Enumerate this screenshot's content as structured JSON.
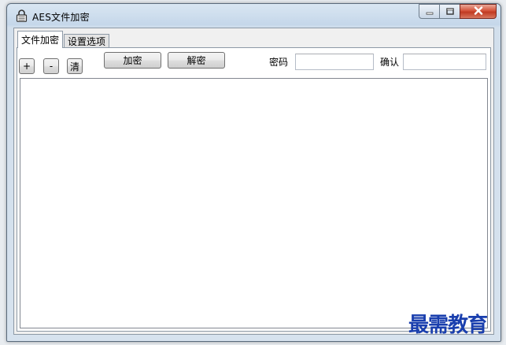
{
  "window": {
    "title": "AES文件加密"
  },
  "tabs": [
    {
      "label": "文件加密"
    },
    {
      "label": "设置选项"
    }
  ],
  "toolbar": {
    "add_label": "+",
    "remove_label": "-",
    "clear_label": "清",
    "encrypt_label": "加密",
    "decrypt_label": "解密"
  },
  "fields": {
    "password_label": "密码",
    "password_value": "",
    "confirm_label": "确认",
    "confirm_value": ""
  },
  "file_list": {
    "value": ""
  },
  "watermark": {
    "text": "最需教育"
  },
  "icons": {
    "app": "lock-icon",
    "minimize": "minimize-icon",
    "maximize": "maximize-icon",
    "close": "close-icon"
  }
}
